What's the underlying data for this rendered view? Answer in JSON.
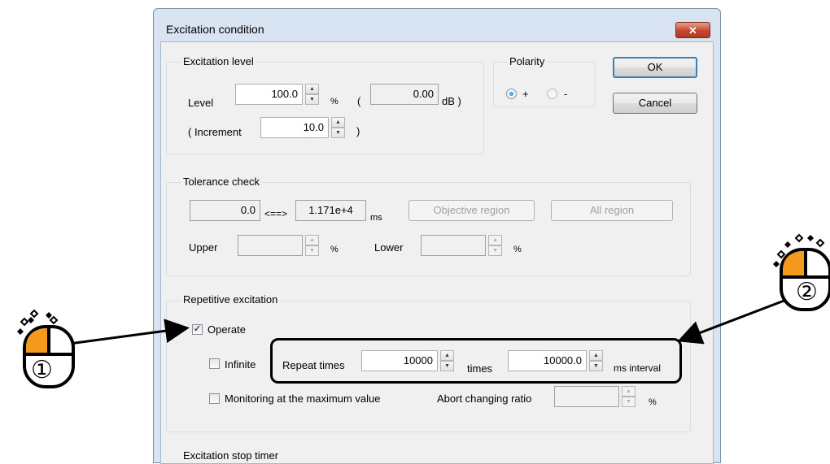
{
  "dialog": {
    "title": "Excitation condition",
    "close_glyph": "✕",
    "ok_label": "OK",
    "cancel_label": "Cancel"
  },
  "excitation_level": {
    "group_label": "Excitation level",
    "level_label": "Level",
    "level_value": "100.0",
    "percent_unit": "%",
    "open_paren": "(",
    "db_value": "0.00",
    "db_unit": "dB )",
    "increment_label": "( Increment",
    "increment_value": "10.0",
    "close_paren": ")"
  },
  "polarity": {
    "group_label": "Polarity",
    "plus_label": "+",
    "minus_label": "-",
    "selected": "+"
  },
  "tolerance_check": {
    "group_label": "Tolerance check",
    "from_value": "0.0",
    "arrow": "<==>",
    "to_value": "1.171e+4",
    "to_unit": "ms",
    "objective_region_label": "Objective region",
    "all_region_label": "All region",
    "upper_label": "Upper",
    "upper_value": "",
    "upper_unit": "%",
    "lower_label": "Lower",
    "lower_value": "",
    "lower_unit": "%"
  },
  "repetitive_excitation": {
    "group_label": "Repetitive excitation",
    "operate_label": "Operate",
    "operate_checked": true,
    "infinite_label": "Infinite",
    "repeat_times_label": "Repeat times",
    "repeat_times_value": "10000",
    "times_unit": "times",
    "interval_value": "10000.0",
    "interval_unit": "ms interval",
    "monitoring_label": "Monitoring at the maximum value",
    "abort_label": "Abort changing ratio",
    "abort_value": "",
    "abort_unit": "%"
  },
  "excitation_stop_timer": {
    "group_label": "Excitation stop timer"
  },
  "annotations": {
    "mouse1_number": "①",
    "mouse2_number": "②"
  },
  "colors": {
    "mouse_button": "#f39a1e",
    "title_bar": "#d8e4f2",
    "close_button": "#c8452e"
  }
}
